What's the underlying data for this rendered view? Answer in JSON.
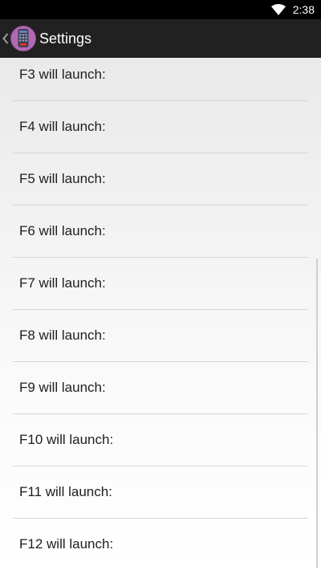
{
  "status_bar": {
    "time": "2:38",
    "icons": [
      "wifi-icon"
    ]
  },
  "action_bar": {
    "title": "Settings",
    "icons": [
      "back-chevron-icon",
      "app-remote-icon"
    ]
  },
  "preferences": [
    {
      "label": "F3 will launch:"
    },
    {
      "label": "F4 will launch:"
    },
    {
      "label": "F5 will launch:"
    },
    {
      "label": "F6 will launch:"
    },
    {
      "label": "F7 will launch:"
    },
    {
      "label": "F8 will launch:"
    },
    {
      "label": "F9 will launch:"
    },
    {
      "label": "F10 will launch:"
    },
    {
      "label": "F11 will launch:"
    },
    {
      "label": "F12 will launch:"
    }
  ],
  "colors": {
    "status_bar_bg": "#000000",
    "action_bar_bg": "#212121",
    "text_primary": "#1e1e1e",
    "divider": "#d6d6d6"
  }
}
